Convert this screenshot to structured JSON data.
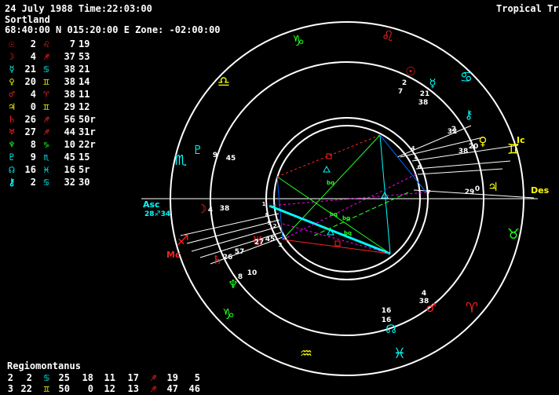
{
  "header": {
    "date_time": "24 July 1988 Time:22:03:00",
    "place": "Sortland",
    "coords": "68:40:00 N 015:20:00 E Zone: -02:00:00",
    "mode": "Tropical True"
  },
  "colors": {
    "fire": "#ff2020",
    "earth": "#20ff20",
    "air": "#ffff00",
    "water": "#00ffff",
    "white": "#ffffff"
  },
  "planets": [
    {
      "glyph": "☉",
      "glyph_color": "#ff2020",
      "deg": "2",
      "sign": "♌",
      "sign_color": "#ff2020",
      "min": "7",
      "sec": "19"
    },
    {
      "glyph": "☽",
      "glyph_color": "#ff2020",
      "deg": "4",
      "sign": "♐",
      "sign_color": "#ff2020",
      "min": "37",
      "sec": "53"
    },
    {
      "glyph": "☿",
      "glyph_color": "#00ffff",
      "deg": "21",
      "sign": "♋",
      "sign_color": "#00ffff",
      "min": "38",
      "sec": "21"
    },
    {
      "glyph": "♀",
      "glyph_color": "#ffff00",
      "deg": "20",
      "sign": "♊",
      "sign_color": "#ffff00",
      "min": "38",
      "sec": "14"
    },
    {
      "glyph": "♂",
      "glyph_color": "#ff2020",
      "deg": "4",
      "sign": "♈",
      "sign_color": "#ff2020",
      "min": "38",
      "sec": "11"
    },
    {
      "glyph": "♃",
      "glyph_color": "#ffff00",
      "deg": "0",
      "sign": "♊",
      "sign_color": "#ffff00",
      "min": "29",
      "sec": "12"
    },
    {
      "glyph": "♄",
      "glyph_color": "#ff2020",
      "deg": "26",
      "sign": "♐",
      "sign_color": "#ff2020",
      "min": "56",
      "sec": "50r"
    },
    {
      "glyph": "♅",
      "glyph_color": "#ff2020",
      "deg": "27",
      "sign": "♐",
      "sign_color": "#ff2020",
      "min": "44",
      "sec": "31r"
    },
    {
      "glyph": "♆",
      "glyph_color": "#20ff20",
      "deg": "8",
      "sign": "♑",
      "sign_color": "#20ff20",
      "min": "10",
      "sec": "22r"
    },
    {
      "glyph": "♇",
      "glyph_color": "#00ffff",
      "deg": "9",
      "sign": "♏",
      "sign_color": "#00ffff",
      "min": "45",
      "sec": "15"
    },
    {
      "glyph": "☊",
      "glyph_color": "#00ffff",
      "deg": "16",
      "sign": "♓",
      "sign_color": "#00ffff",
      "min": "16",
      "sec": "5r"
    },
    {
      "glyph": "⚷",
      "glyph_color": "#00ffff",
      "deg": "2",
      "sign": "♋",
      "sign_color": "#00ffff",
      "min": "32",
      "sec": "30"
    }
  ],
  "house_system": "Regiomontanus",
  "houses_row1": [
    {
      "t": "2",
      "c": "#ffffff"
    },
    {
      "t": "2",
      "c": "#ffffff"
    },
    {
      "t": "♋",
      "c": "#00ffff"
    },
    {
      "t": "25",
      "c": "#ffffff"
    },
    {
      "t": "18",
      "c": "#ffffff"
    },
    {
      "t": "11",
      "c": "#ffffff"
    },
    {
      "t": "17",
      "c": "#ffffff"
    },
    {
      "t": "♐",
      "c": "#ff2020"
    },
    {
      "t": "19",
      "c": "#ffffff"
    },
    {
      "t": "5",
      "c": "#ffffff"
    }
  ],
  "houses_row2": [
    {
      "t": "3",
      "c": "#ffffff"
    },
    {
      "t": "22",
      "c": "#ffffff"
    },
    {
      "t": "♊",
      "c": "#ffff00"
    },
    {
      "t": "50",
      "c": "#ffffff"
    },
    {
      "t": "0",
      "c": "#ffffff"
    },
    {
      "t": "12",
      "c": "#ffffff"
    },
    {
      "t": "13",
      "c": "#ffffff"
    },
    {
      "t": "♐",
      "c": "#ff2020"
    },
    {
      "t": "47",
      "c": "#ffffff"
    },
    {
      "t": "46",
      "c": "#ffffff"
    }
  ],
  "wheel": {
    "zodiac": [
      {
        "glyph": "♑",
        "color": "#20ff20"
      },
      {
        "glyph": "♌",
        "color": "#ff2020"
      },
      {
        "glyph": "♋",
        "color": "#00ffff"
      },
      {
        "glyph": "♊",
        "color": "#ffff00"
      },
      {
        "glyph": "♉",
        "color": "#20ff20"
      },
      {
        "glyph": "♈",
        "color": "#ff2020"
      },
      {
        "glyph": "♓",
        "color": "#00ffff"
      },
      {
        "glyph": "♒",
        "color": "#ffff00"
      },
      {
        "glyph": "♑",
        "color": "#20ff20"
      },
      {
        "glyph": "♐",
        "color": "#ff2020"
      },
      {
        "glyph": "♏",
        "color": "#00ffff"
      },
      {
        "glyph": "♎",
        "color": "#ffff00"
      }
    ],
    "axis_labels": {
      "asc": "Asc",
      "asc_deg": "28♐34",
      "des": "Des",
      "ic": "Ic",
      "mc": "Mc"
    },
    "planet_labels": [
      {
        "glyph": "☉",
        "color": "#ff2020",
        "deg": "2",
        "min": "7"
      },
      {
        "glyph": "☿",
        "color": "#00ffff",
        "deg": "21",
        "min": "38"
      },
      {
        "glyph": "⚷",
        "color": "#00ffff",
        "deg": "2",
        "min": "32"
      },
      {
        "glyph": "♀",
        "color": "#ffff00",
        "deg": "20",
        "min": "38"
      },
      {
        "glyph": "♃",
        "color": "#ffff00",
        "deg": "0",
        "min": "29"
      },
      {
        "glyph": "♂",
        "color": "#ff2020",
        "deg": "4",
        "min": "38"
      },
      {
        "glyph": "☊",
        "color": "#00ffff",
        "deg": "16",
        "min": "16"
      },
      {
        "glyph": "♆",
        "color": "#20ff20",
        "deg": "8",
        "min": "10"
      },
      {
        "glyph": "♅",
        "color": "#ff2020",
        "deg": "27",
        "min": "45"
      },
      {
        "glyph": "♄",
        "color": "#ff2020",
        "deg": "26",
        "min": "57"
      },
      {
        "glyph": "☽",
        "color": "#ff2020",
        "deg": "4",
        "min": "38"
      },
      {
        "glyph": "♇",
        "color": "#00ffff",
        "deg": "9",
        "min": "45"
      }
    ],
    "house_numbers": [
      "1",
      "2",
      "3",
      "4",
      "5",
      "6",
      "7",
      "8",
      "9"
    ],
    "aspect_labels": [
      "bq",
      "bq",
      "bq",
      "bq"
    ]
  }
}
